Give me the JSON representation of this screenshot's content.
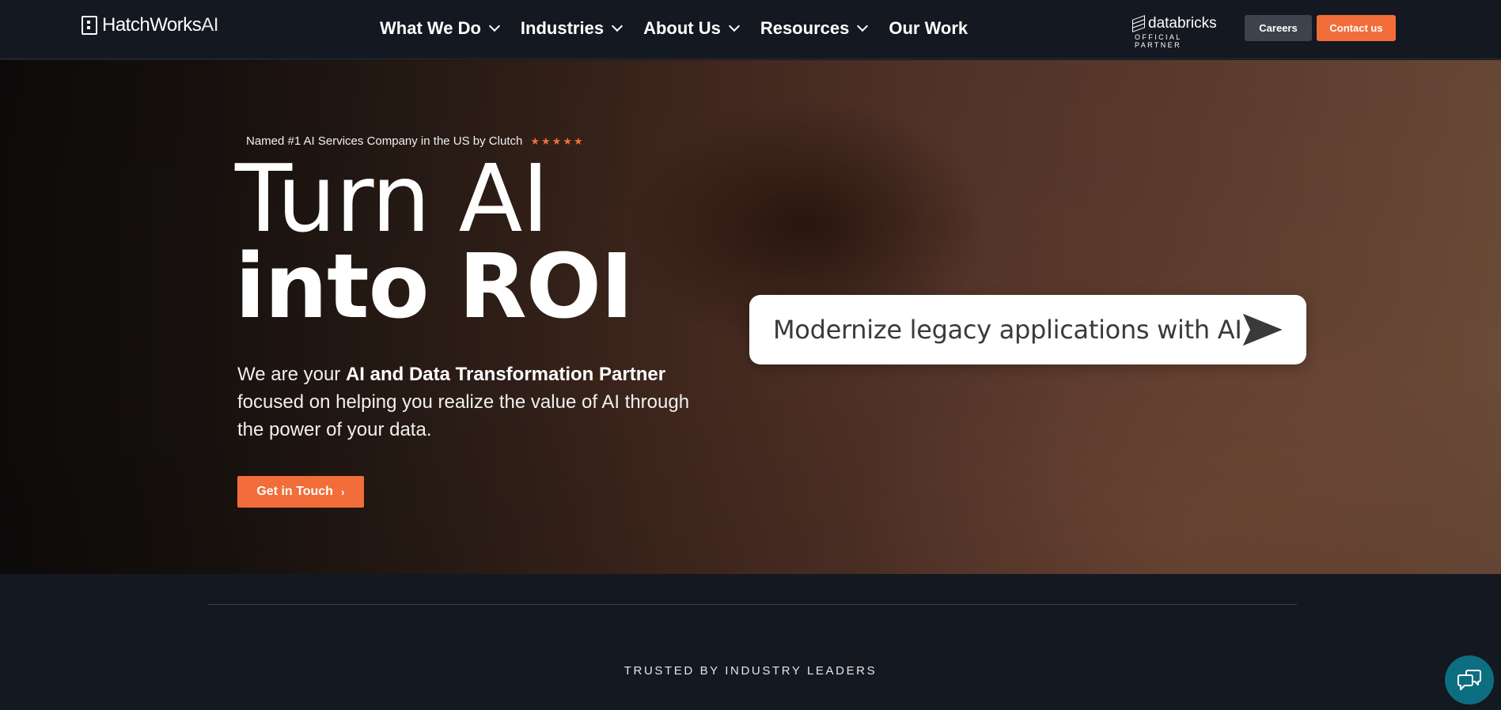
{
  "header": {
    "logo": {
      "brand": "HatchWorks",
      "suffix": "AI"
    },
    "nav": [
      {
        "label": "What We Do",
        "has_dropdown": true
      },
      {
        "label": "Industries",
        "has_dropdown": true
      },
      {
        "label": "About Us",
        "has_dropdown": true
      },
      {
        "label": "Resources",
        "has_dropdown": true
      },
      {
        "label": "Our Work",
        "has_dropdown": false
      }
    ],
    "partner": {
      "name": "databricks",
      "subtitle": "OFFICIAL PARTNER"
    },
    "careers_label": "Careers",
    "contact_label": "Contact us"
  },
  "hero": {
    "badge_text": "Named #1 AI Services Company in the US by Clutch",
    "rating_stars": 5,
    "title_line1": "Turn AI",
    "title_line2": "into ROI",
    "desc_prefix": "We are your ",
    "desc_bold": "AI and Data Transformation Partner",
    "desc_suffix": " focused on helping you realize the value of AI through the power of your data.",
    "cta_label": "Get in Touch",
    "prompt_text": "Modernize legacy applications with AI"
  },
  "section": {
    "trusted_label": "TRUSTED BY INDUSTRY LEADERS"
  },
  "colors": {
    "accent": "#f26d39",
    "background": "#141820",
    "chat": "#0d6e82"
  },
  "icons": {
    "nav_dropdown": "chevron-down-icon",
    "rating": "star-icon",
    "cta_arrow": "chevron-right-icon",
    "prompt_send": "send-icon",
    "chat": "chat-bubbles-icon"
  }
}
